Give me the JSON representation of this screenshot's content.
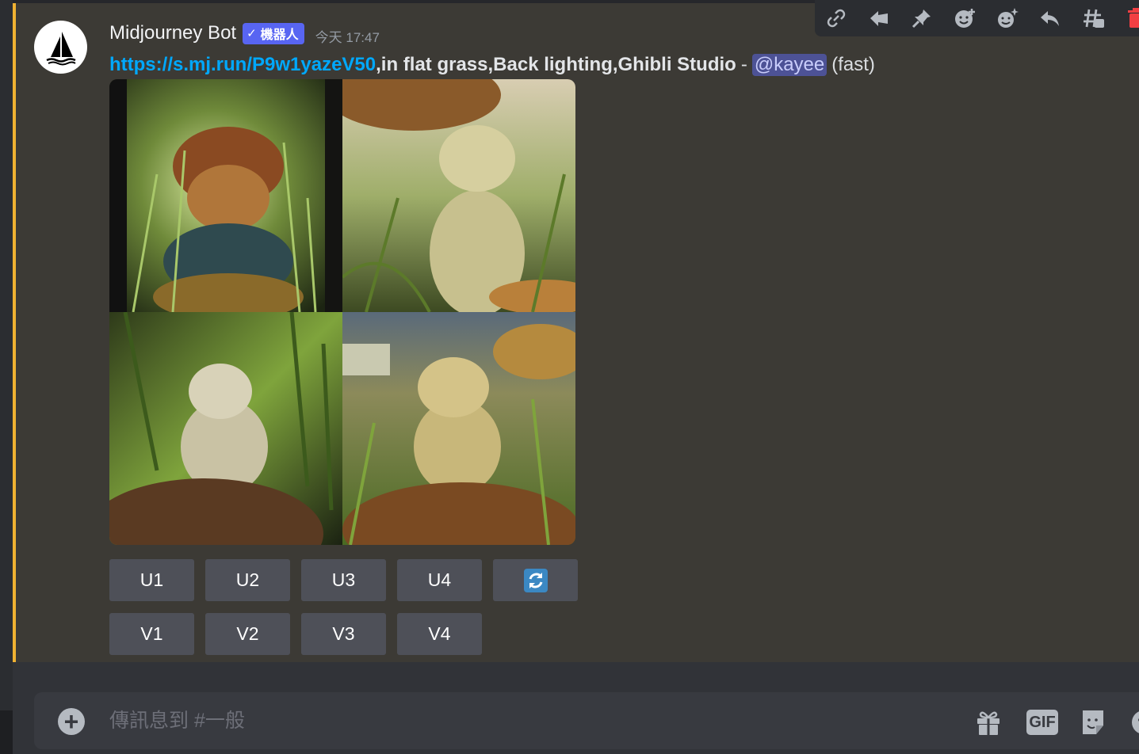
{
  "message": {
    "username": "Midjourney Bot",
    "bot_tag": "機器人",
    "bot_tag_check": "✓",
    "timestamp": "今天 17:47",
    "link": "https://s.mj.run/P9w1yazeV50",
    "prompt": ",in flat grass,Back lighting,Ghibli Studio",
    "separator": "-",
    "mention": "@kayee",
    "speed": "(fast)",
    "accent_color": "#f0b232"
  },
  "image_grid": {
    "tiles": [
      "cat-in-hat-in-grass",
      "cat-under-wicker-chair",
      "kitten-on-basket-in-grass",
      "kitten-by-wicker-stool"
    ]
  },
  "buttons": {
    "upscale": [
      "U1",
      "U2",
      "U3",
      "U4"
    ],
    "variation": [
      "V1",
      "V2",
      "V3",
      "V4"
    ],
    "reroll_icon": "refresh-icon"
  },
  "toolbar": {
    "icons": [
      "link-icon",
      "forward-icon",
      "pin-icon",
      "add-reaction-icon",
      "super-reaction-icon",
      "reply-icon",
      "create-thread-icon",
      "delete-icon"
    ]
  },
  "composer": {
    "placeholder": "傳訊息到 #一般",
    "plus_label": "+",
    "gif_label": "GIF",
    "icons": [
      "gift-icon",
      "gif-icon",
      "sticker-icon",
      "emoji-icon"
    ]
  }
}
